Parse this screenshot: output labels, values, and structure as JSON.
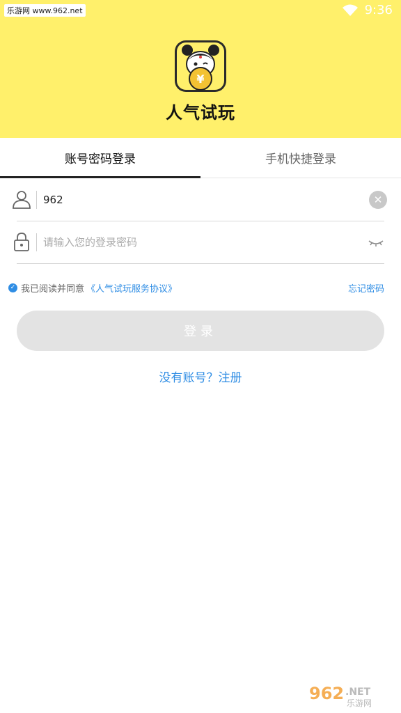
{
  "status_bar": {
    "watermark": "乐游网 www.962.net",
    "time": "9:36"
  },
  "app": {
    "name": "人气试玩",
    "logo_icon": "yuan-coin-mascot-icon"
  },
  "tabs": [
    {
      "label": "账号密码登录",
      "active": true
    },
    {
      "label": "手机快捷登录",
      "active": false
    }
  ],
  "account": {
    "value": "962",
    "icon": "user-icon"
  },
  "password": {
    "placeholder": "请输入您的登录密码",
    "icon": "lock-icon"
  },
  "agreement": {
    "prefix": "我已阅读并同意",
    "link": "《人气试玩服务协议》",
    "checked": true
  },
  "forgot_label": "忘记密码",
  "login_label": "登录",
  "register_label": "没有账号？注册",
  "bottom_watermark": "962.NET 乐游网",
  "colors": {
    "header_bg": "#fff06b",
    "link": "#2f8de4",
    "button_disabled": "#e3e3e3"
  }
}
